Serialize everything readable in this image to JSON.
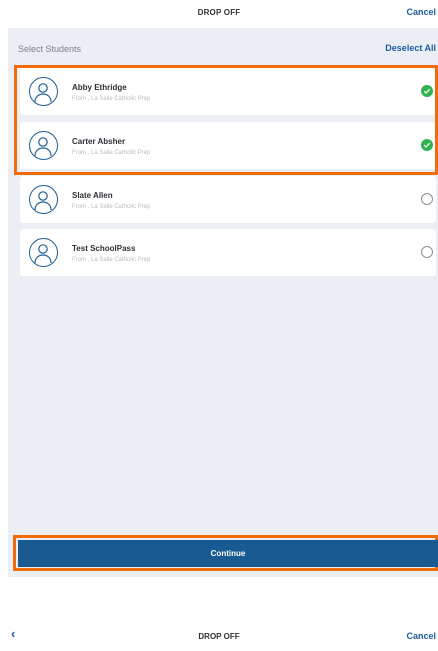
{
  "header": {
    "title": "DROP OFF",
    "cancel_label": "Cancel"
  },
  "selection": {
    "section_label": "Select Students",
    "deselect_all_label": "Deselect All"
  },
  "students": [
    {
      "name": "Abby Ethridge",
      "school": "From , La Salle Catholic Prep",
      "selected": true
    },
    {
      "name": "Carter Absher",
      "school": "From , La Salle Catholic Prep",
      "selected": true
    },
    {
      "name": "Slate Allen",
      "school": "From , La Salle Catholic Prep",
      "selected": false
    },
    {
      "name": "Test SchoolPass",
      "school": "From , La Salle Catholic Prep",
      "selected": false
    }
  ],
  "continue_label": "Continue",
  "footer": {
    "back_icon": "chevron-left-icon",
    "title": "DROP OFF",
    "cancel_label": "Cancel"
  },
  "colors": {
    "accent": "#1f5aa6",
    "button": "#1a5a92",
    "selected": "#2fb24f",
    "highlight": "#f26b0c"
  }
}
